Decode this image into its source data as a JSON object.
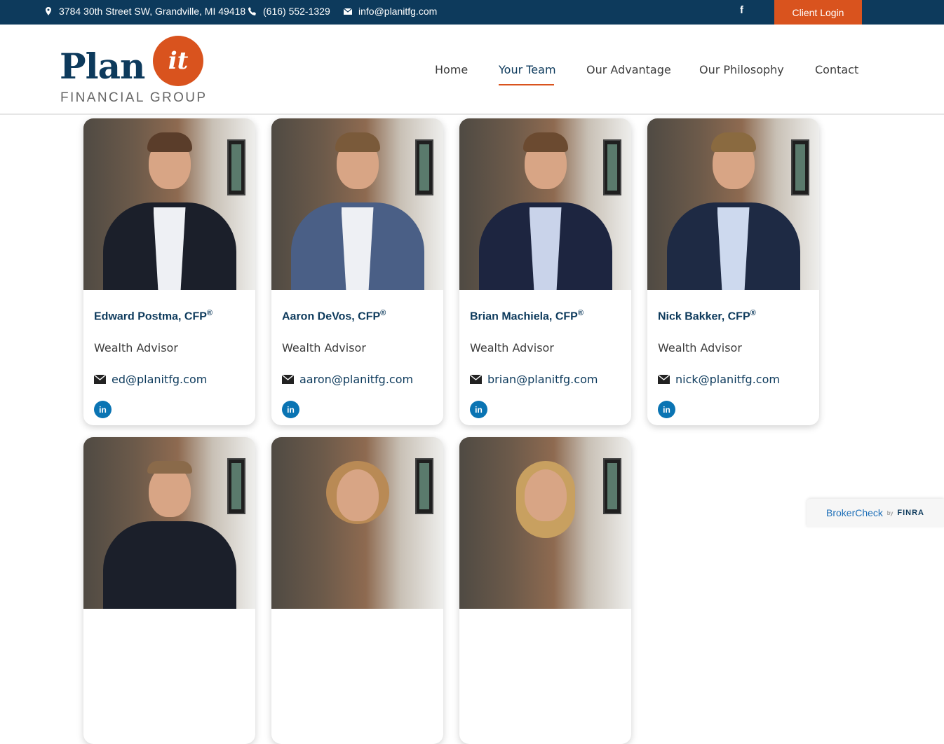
{
  "topbar": {
    "address": "3784 30th Street SW, Grandville,  MI 49418",
    "phone": "(616) 552-1329",
    "email": "info@planitfg.com",
    "facebook": "f",
    "client_login": "Client Login"
  },
  "logo": {
    "plan": "Plan",
    "it": "it",
    "sub": "FINANCIAL GROUP"
  },
  "nav": [
    {
      "label": "Home"
    },
    {
      "label": "Your Team",
      "active": true
    },
    {
      "label": "Our Advantage"
    },
    {
      "label": "Our Philosophy"
    },
    {
      "label": "Contact"
    }
  ],
  "team": [
    {
      "name": "Edward Postma, CFP",
      "sup": "®",
      "role": "Wealth Advisor",
      "email": "ed@planitfg.com",
      "linkedin": "in"
    },
    {
      "name": "Aaron DeVos, CFP",
      "sup": "®",
      "role": "Wealth Advisor",
      "email": "aaron@planitfg.com",
      "linkedin": "in"
    },
    {
      "name": "Brian Machiela, CFP",
      "sup": "®",
      "role": "Wealth Advisor",
      "email": "brian@planitfg.com",
      "linkedin": "in"
    },
    {
      "name": "Nick Bakker, CFP",
      "sup": "®",
      "role": "Wealth Advisor",
      "email": "nick@planitfg.com",
      "linkedin": "in"
    }
  ],
  "broker": {
    "brand": "BrokerCheck",
    "by": "by",
    "finra": "FINRA"
  },
  "colors": {
    "navy": "#0d3a5c",
    "orange": "#d9531e",
    "linkedin": "#0a74b3"
  }
}
